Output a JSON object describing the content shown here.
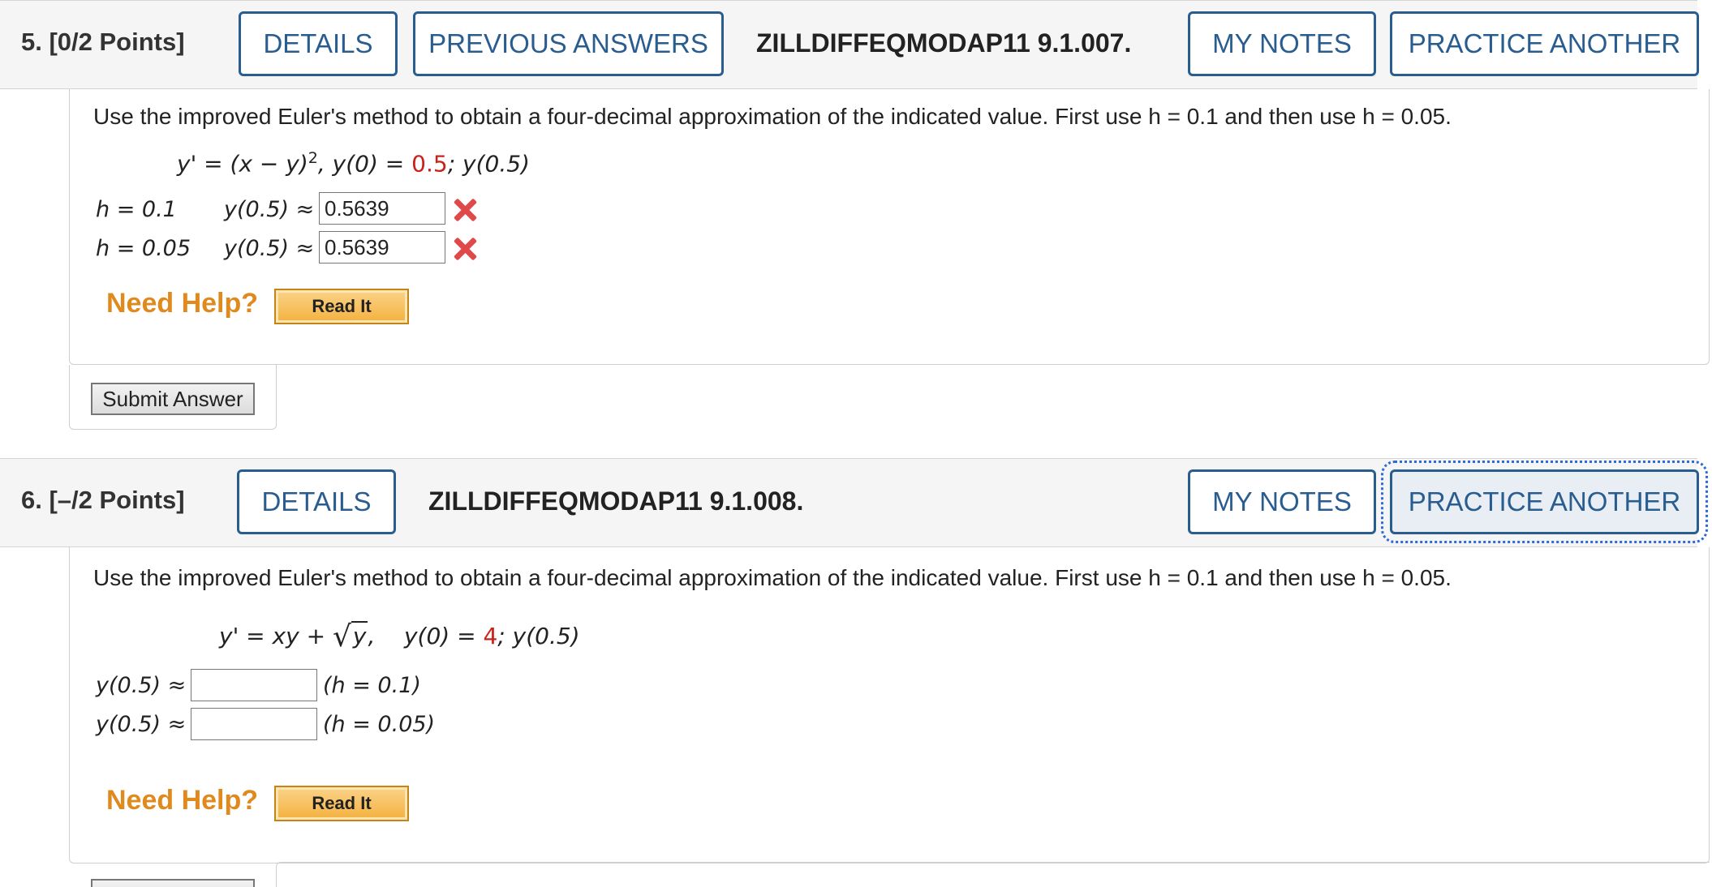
{
  "q5": {
    "points": "5. [0/2 Points]",
    "details": "DETAILS",
    "previous": "PREVIOUS ANSWERS",
    "code": "ZILLDIFFEQMODAP11 9.1.007.",
    "notes": "MY NOTES",
    "practice": "PRACTICE ANOTHER",
    "prompt": "Use the improved Euler's method to obtain a four-decimal approximation of the indicated value. First use h = 0.1 and then use h = 0.05.",
    "eq_lhs": "y' = (x − y)",
    "eq_exp": "2",
    "eq_mid": ", y(0) = ",
    "eq_init": "0.5",
    "eq_end": "; y(0.5)",
    "rows": [
      {
        "h": "h = 0.1",
        "label": "y(0.5) ≈",
        "value": "0.5639"
      },
      {
        "h": "h = 0.05",
        "label": "y(0.5) ≈",
        "value": "0.5639"
      }
    ],
    "need_help": "Need Help?",
    "read_it": "Read It",
    "submit": "Submit Answer"
  },
  "q6": {
    "points": "6. [–/2 Points]",
    "details": "DETAILS",
    "code": "ZILLDIFFEQMODAP11 9.1.008.",
    "notes": "MY NOTES",
    "practice": "PRACTICE ANOTHER",
    "prompt": "Use the improved Euler's method to obtain a four-decimal approximation of the indicated value. First use h = 0.1 and then use h = 0.05.",
    "eq_lhs": "y' = xy + ",
    "eq_sqrt": "y",
    "eq_mid": ",    y(0) = ",
    "eq_init": "4",
    "eq_end": "; y(0.5)",
    "rows": [
      {
        "label": "y(0.5) ≈",
        "value": "",
        "h": "(h = 0.1)"
      },
      {
        "label": "y(0.5) ≈",
        "value": "",
        "h": "(h = 0.05)"
      }
    ],
    "need_help": "Need Help?",
    "read_it": "Read It"
  },
  "colors": {
    "accent": "#2a5d8f",
    "error": "#e0494a",
    "help": "#e08a1e",
    "initial": "#c8231b"
  }
}
